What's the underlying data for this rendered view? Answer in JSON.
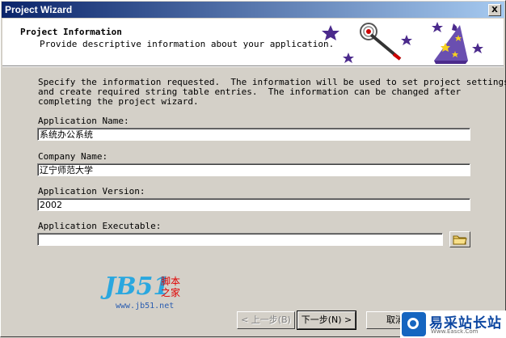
{
  "window": {
    "title": "Project Wizard",
    "close_glyph": "X"
  },
  "header": {
    "title": "Project Information",
    "subtitle": "Provide descriptive information about your application.",
    "art_icon": "wizard-hat-wand-stars"
  },
  "description": "Specify the information requested.  The information will be used to set project settings\nand create required string table entries.  The information can be changed after\ncompleting the project wizard.",
  "fields": {
    "app_name": {
      "label": "Application Name:",
      "value": "系统办公系统"
    },
    "company": {
      "label": "Company Name:",
      "value": "辽宁师范大学"
    },
    "version": {
      "label": "Application Version:",
      "value": "2002"
    },
    "executable": {
      "label": "Application Executable:",
      "value": ""
    }
  },
  "buttons": {
    "back": "< 上一步(B)",
    "next": "下一步(N) >",
    "cancel": "取消"
  },
  "watermarks": {
    "left": {
      "logo": "JB51",
      "cn1": "脚本",
      "cn2": "之家",
      "url": "www.jb51.net"
    },
    "right": {
      "name": "易采站长站",
      "site": "Www.Easck.Com"
    }
  }
}
